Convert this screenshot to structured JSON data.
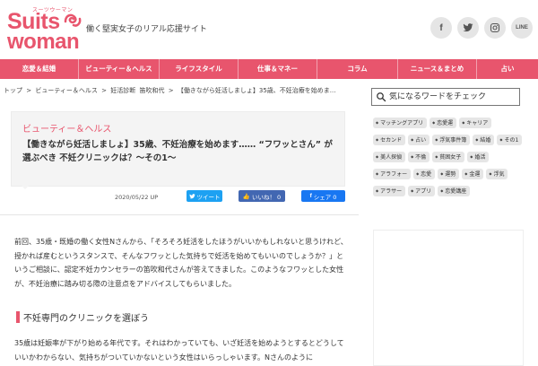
{
  "header": {
    "logo_small": "スーツウーマン",
    "logo_line1": "Suits",
    "logo_line2": "woman",
    "tagline": "働く堅実女子のリアル応援サイト",
    "social": [
      {
        "name": "facebook-icon",
        "glyph": "f"
      },
      {
        "name": "twitter-icon",
        "glyph": "t"
      },
      {
        "name": "instagram-icon",
        "glyph": "◎"
      },
      {
        "name": "line-icon",
        "glyph": "LINE"
      }
    ]
  },
  "nav": {
    "items": [
      "恋愛＆結婚",
      "ビューティー＆ヘルス",
      "ライフスタイル",
      "仕事＆マネー",
      "コラム",
      "ニュース＆まとめ",
      "占い"
    ]
  },
  "breadcrumb": {
    "items": [
      "トップ",
      ">",
      "ビューティー＆ヘルス",
      ">",
      "妊活診断",
      "笛吹和代",
      ">",
      "【働きながら妊活しましょ】35歳、不妊治療を始めま..."
    ]
  },
  "article": {
    "category": "ビューティー＆ヘルス",
    "title": "【働きながら妊活しましょ】35歳、不妊治療を始めます…… “フワッとさん” が 選ぶべき 不妊クリニックは？〜その1〜",
    "date": "2020/05/22",
    "date_suffix": "UP",
    "tweet_label": "ツイート",
    "like_label": "いいね！ 0",
    "share_label": "シェア 0",
    "paragraph1": "前回、35歳・既婚の働く女性Nさんから、「そろそろ妊活をしたほうがいいかもしれないと思うけれど、授かれば産むというスタンスで、そんなフワッとした気持ちで妊活を始めてもいいのでしょうか？」というご相談に、認定不妊カウンセラーの笛吹和代さんが答えてきました。このようなフワッとした女性が、不妊治療に踏み切る際の注意点をアドバイスしてもらいました。",
    "section_heading": "不妊専門のクリニックを選ぼう",
    "paragraph2": "35歳は妊娠率が下がり始める年代です。それはわかっていても、いざ妊活を始めようとするとどうしていいかわからない、気持ちがついていかないという女性はいらっしゃいます。Nさんのように"
  },
  "sidebar": {
    "search_placeholder": "気になるワードをチェック",
    "tags": [
      "マッチングアプリ",
      "恋愛運",
      "キャリア",
      "セカンド",
      "占い",
      "浮気事件簿",
      "結婚",
      "その1",
      "美人探偵",
      "不倫",
      "貧困女子",
      "婚活",
      "アラフォー",
      "恋愛",
      "運勢",
      "金運",
      "浮気",
      "アラサー",
      "アプリ",
      "恋愛講座"
    ]
  },
  "colors": {
    "brand": "#e8556d",
    "tweet": "#1da1f2",
    "like": "#4267b2",
    "share": "#1877f2"
  }
}
